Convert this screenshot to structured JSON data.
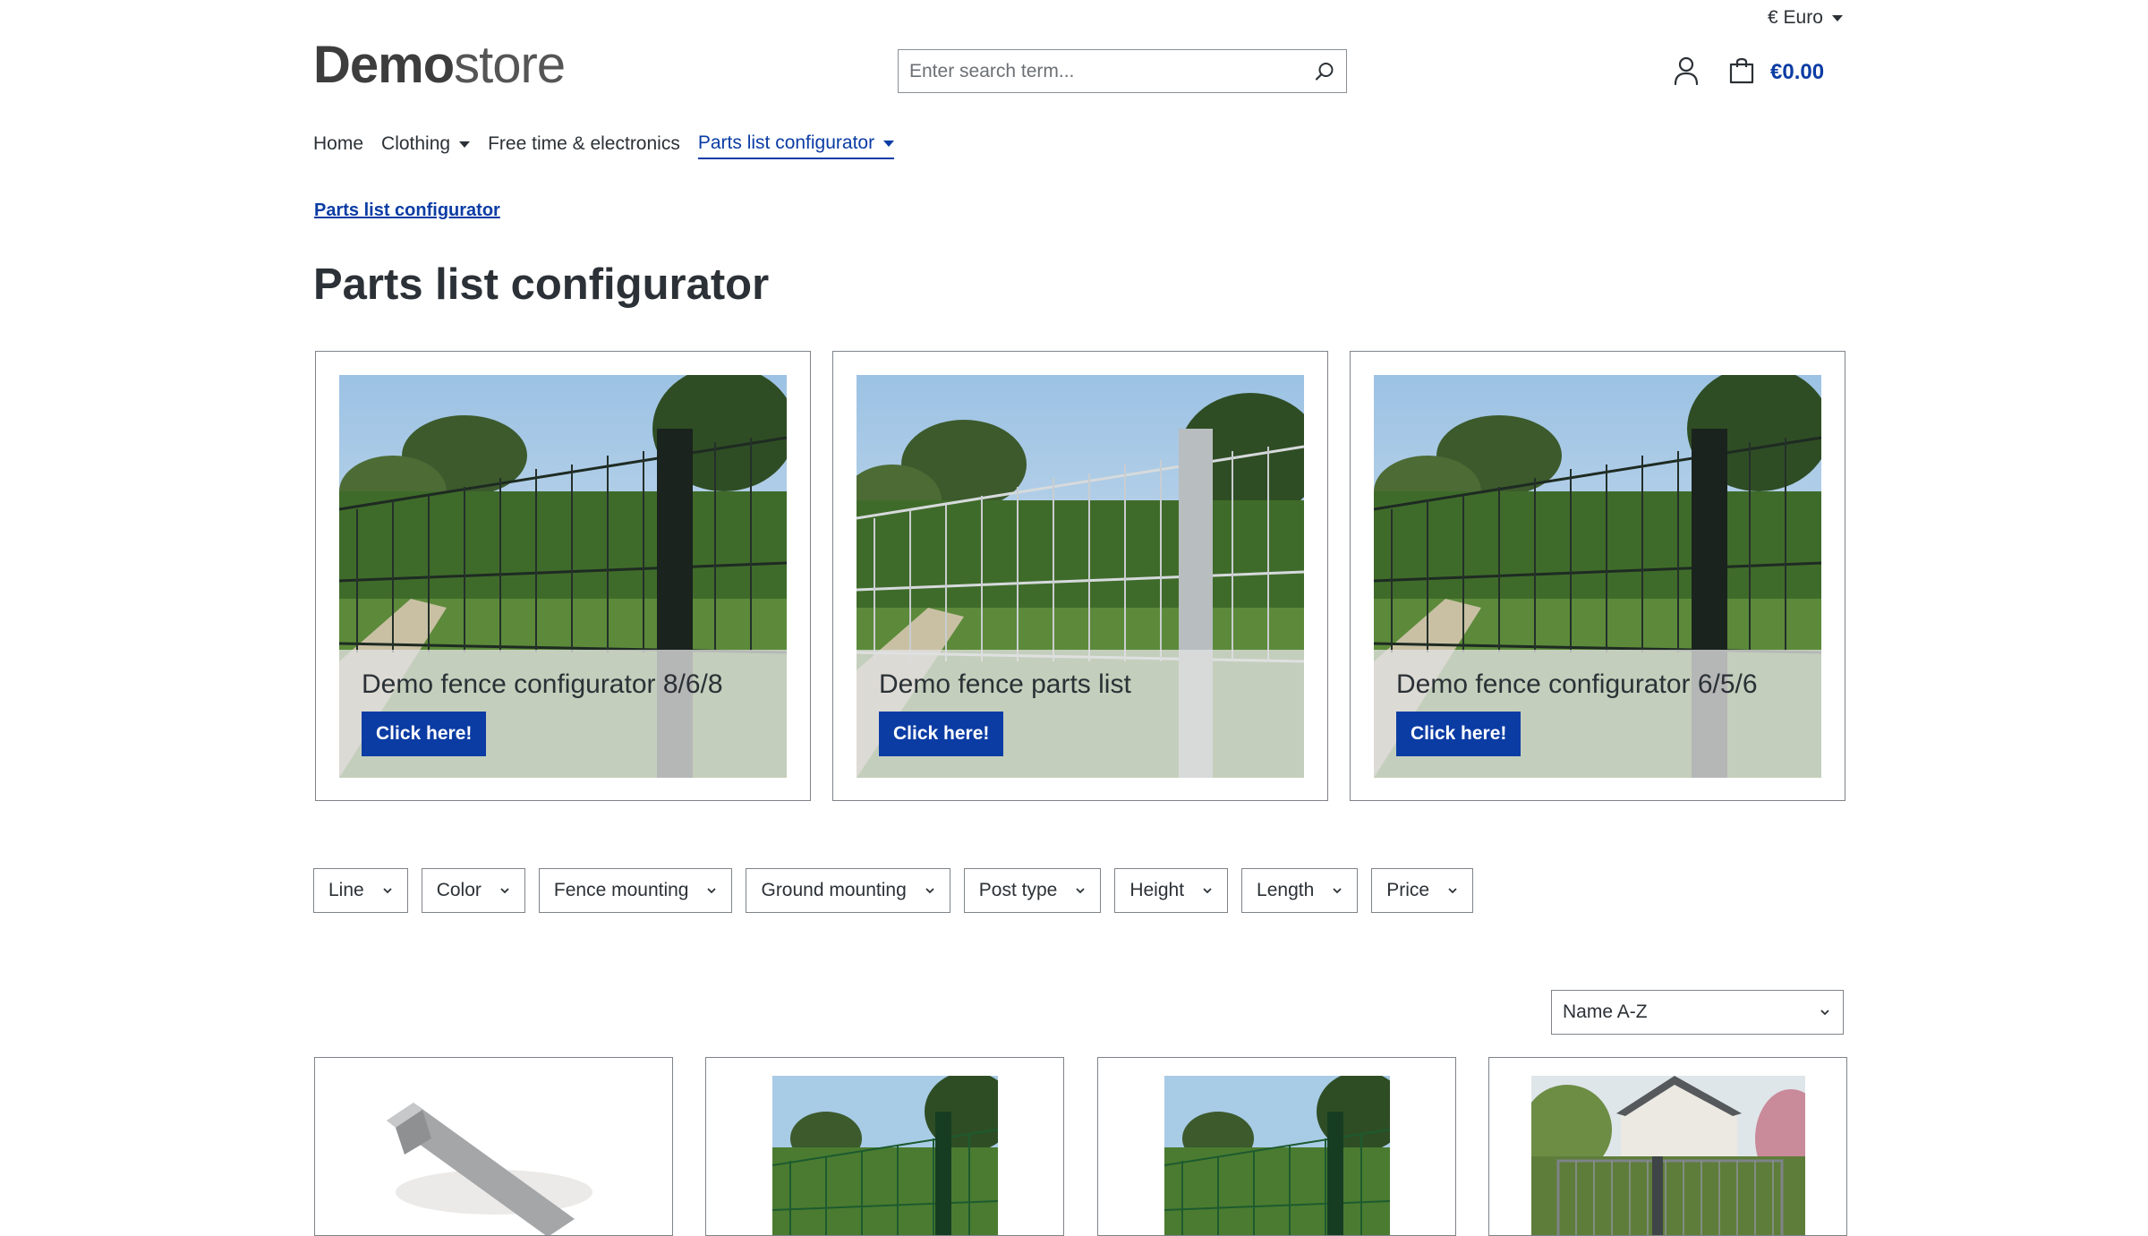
{
  "header": {
    "currency": "€ Euro",
    "logo_bold": "Demo",
    "logo_light": "store",
    "search_placeholder": "Enter search term...",
    "cart_total": "€0.00"
  },
  "nav": {
    "items": [
      {
        "label": "Home"
      },
      {
        "label": "Clothing"
      },
      {
        "label": "Free time & electronics"
      },
      {
        "label": "Parts list configurator"
      }
    ]
  },
  "breadcrumb": "Parts list configurator",
  "page_title": "Parts list configurator",
  "cards": [
    {
      "title": "Demo fence configurator 8/6/8",
      "button": "Click here!"
    },
    {
      "title": "Demo fence parts list",
      "button": "Click here!"
    },
    {
      "title": "Demo fence configurator 6/5/6",
      "button": "Click here!"
    }
  ],
  "filters": [
    "Line",
    "Color",
    "Fence mounting",
    "Ground mounting",
    "Post type",
    "Height",
    "Length",
    "Price"
  ],
  "sort": {
    "selected": "Name A-Z"
  },
  "colors": {
    "accent": "#0b3ca4",
    "text": "#2b3136",
    "border": "#7f8489"
  }
}
